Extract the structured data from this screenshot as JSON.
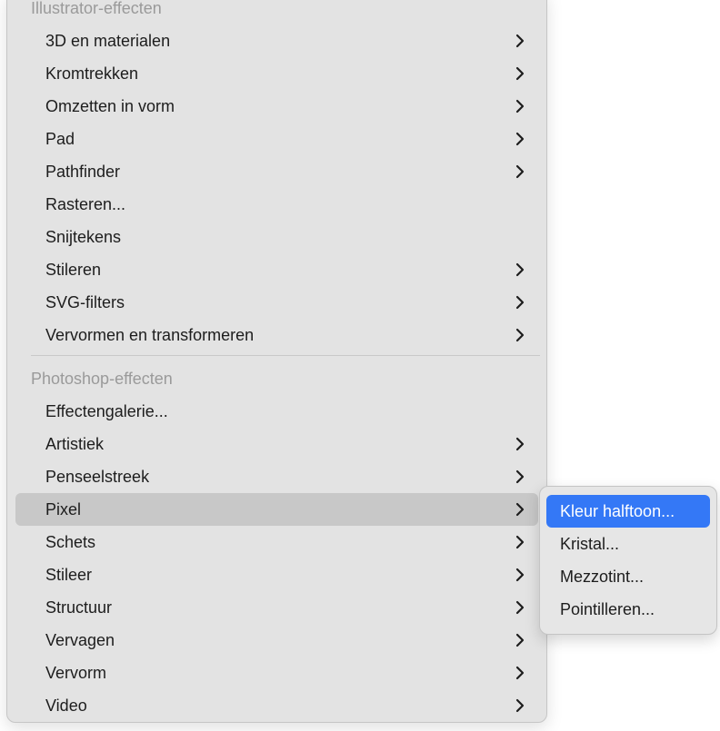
{
  "main_menu": {
    "illustrator_header": "Illustrator-effecten",
    "illustrator_items": [
      {
        "label": "3D en materialen",
        "has_submenu": true
      },
      {
        "label": "Kromtrekken",
        "has_submenu": true
      },
      {
        "label": "Omzetten in vorm",
        "has_submenu": true
      },
      {
        "label": "Pad",
        "has_submenu": true
      },
      {
        "label": "Pathfinder",
        "has_submenu": true
      },
      {
        "label": "Rasteren...",
        "has_submenu": false
      },
      {
        "label": "Snijtekens",
        "has_submenu": false
      },
      {
        "label": "Stileren",
        "has_submenu": true
      },
      {
        "label": "SVG-filters",
        "has_submenu": true
      },
      {
        "label": "Vervormen en transformeren",
        "has_submenu": true
      }
    ],
    "photoshop_header": "Photoshop-effecten",
    "photoshop_items": [
      {
        "label": "Effectengalerie...",
        "has_submenu": false
      },
      {
        "label": "Artistiek",
        "has_submenu": true
      },
      {
        "label": "Penseelstreek",
        "has_submenu": true
      },
      {
        "label": "Pixel",
        "has_submenu": true,
        "highlighted": true
      },
      {
        "label": "Schets",
        "has_submenu": true
      },
      {
        "label": "Stileer",
        "has_submenu": true
      },
      {
        "label": "Structuur",
        "has_submenu": true
      },
      {
        "label": "Vervagen",
        "has_submenu": true
      },
      {
        "label": "Vervorm",
        "has_submenu": true
      },
      {
        "label": "Video",
        "has_submenu": true
      }
    ]
  },
  "sub_menu": {
    "items": [
      {
        "label": "Kleur halftoon...",
        "selected": true
      },
      {
        "label": "Kristal...",
        "selected": false
      },
      {
        "label": "Mezzotint...",
        "selected": false
      },
      {
        "label": "Pointilleren...",
        "selected": false
      }
    ]
  },
  "colors": {
    "menu_background": "#e3e3e3",
    "highlight": "#c8c8c8",
    "selection_accent": "#3478f6",
    "header_text": "#9a9a9a"
  },
  "icons": {
    "submenu_indicator": "chevron-right-icon"
  }
}
